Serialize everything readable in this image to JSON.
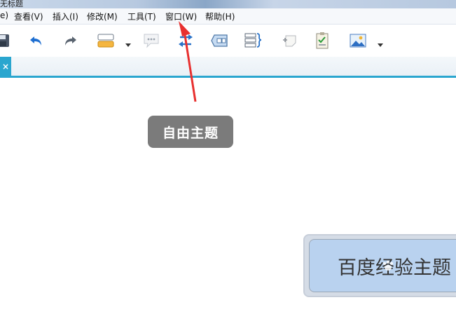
{
  "window": {
    "title": "无标题"
  },
  "menubar": {
    "items": [
      {
        "label": "e)"
      },
      {
        "label": "查看(V)"
      },
      {
        "label": "插入(I)"
      },
      {
        "label": "修改(M)"
      },
      {
        "label": "工具(T)"
      },
      {
        "label": "窗口(W)"
      },
      {
        "label": "帮助(H)"
      }
    ]
  },
  "toolbar": {
    "icons": [
      "save-icon",
      "undo-icon",
      "redo-icon",
      "topic-style-icon",
      "callout-icon",
      "relationship-icon",
      "boundary-icon",
      "summary-icon",
      "insert-topic-icon",
      "task-icon",
      "image-icon"
    ]
  },
  "tab": {
    "close_label": "×"
  },
  "canvas": {
    "floating_topic": "自由主题",
    "central_topic": "百度经验主题"
  },
  "colors": {
    "accent": "#2aa6cf",
    "arrow": "#e8302f",
    "floating_topic_bg": "#7b7b7b",
    "central_topic_bg": "#b9d2ef"
  }
}
